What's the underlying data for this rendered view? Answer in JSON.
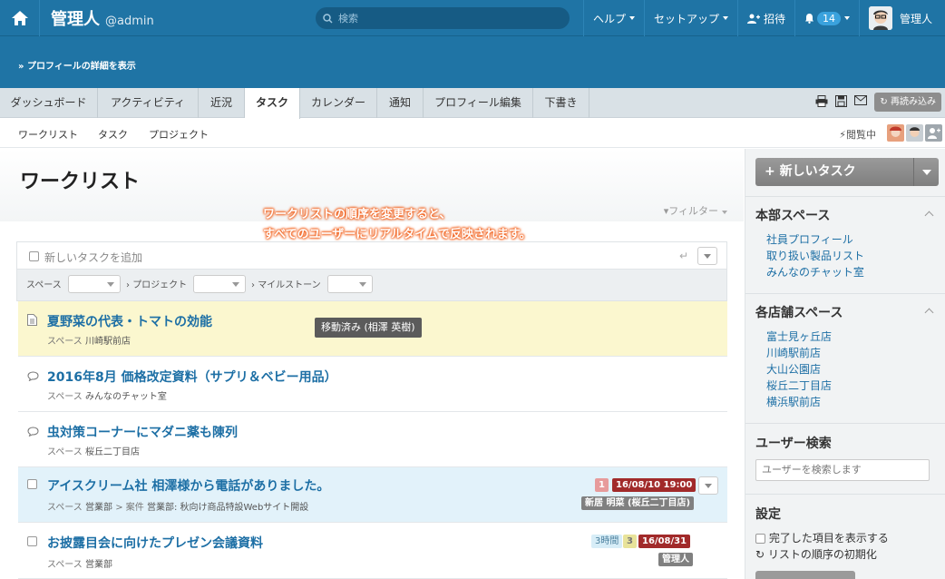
{
  "header": {
    "brand": "管理人",
    "handle": "@admin",
    "search_placeholder": "検索",
    "help": "ヘルプ",
    "setup": "セットアップ",
    "invite": "招待",
    "notif_count": "14",
    "user_name": "管理人"
  },
  "profile": {
    "details_link": "» プロフィールの詳細を表示"
  },
  "tabs": [
    "ダッシュボード",
    "アクティビティ",
    "近況",
    "タスク",
    "カレンダー",
    "通知",
    "プロフィール編集",
    "下書き"
  ],
  "active_tab": "タスク",
  "reload": "再読み込み",
  "subtabs": [
    "ワークリスト",
    "タスク",
    "プロジェクト"
  ],
  "viewing": "閲覧中",
  "page": {
    "title": "ワークリスト",
    "filter": "フィルター",
    "callout_line1": "ワークリストの順序を変更すると、",
    "callout_line2": "すべてのユーザーにリアルタイムで反映されます。"
  },
  "form": {
    "add_placeholder": "新しいタスクを追加",
    "space_label": "スペース",
    "project_label": "プロジェクト",
    "milestone_label": "マイルストーン"
  },
  "tooltip": "移動済み (相澤 英樹)",
  "tasks": [
    {
      "title": "夏野菜の代表・トマトの効能",
      "meta_label": "スペース",
      "meta_value": "川崎駅前店",
      "icon": "document-icon",
      "bg": "#fbf7cf"
    },
    {
      "title": "2016年8月 価格改定資料（サプリ＆ベビー用品）",
      "meta_label": "スペース",
      "meta_value": "みんなのチャット室",
      "icon": "comment-icon",
      "bg": "#ffffff"
    },
    {
      "title": "虫対策コーナーにマダニ薬も陳列",
      "meta_label": "スペース",
      "meta_value": "桜丘二丁目店",
      "icon": "comment-icon",
      "bg": "#ffffff"
    },
    {
      "title": "アイスクリーム社 相澤様から電話がありました。",
      "meta_label": "スペース",
      "meta_value": "営業部",
      "meta_extra_label": "案件",
      "meta_extra_value": "営業部: 秋向け商品特設Webサイト開設",
      "icon": "checkbox-icon",
      "bg": "#e2f2fa",
      "badge_num": "1",
      "due": "16/08/10 19:00",
      "assignee": "新居 明菜 (桜丘二丁目店)"
    },
    {
      "title": "お披露目会に向けたプレゼン会議資料",
      "meta_label": "スペース",
      "meta_value": "営業部",
      "icon": "checkbox-icon",
      "bg": "#ffffff",
      "estimate": "3時間",
      "badge_num": "3",
      "due": "16/08/31",
      "assignee": "管理人"
    }
  ],
  "sidebar": {
    "new_task": "新しいタスク",
    "hq_heading": "本部スペース",
    "hq_links": [
      "社員プロフィール",
      "取り扱い製品リスト",
      "みんなのチャット室"
    ],
    "store_heading": "各店舗スペース",
    "store_links": [
      "富士見ヶ丘店",
      "川崎駅前店",
      "大山公園店",
      "桜丘二丁目店",
      "横浜駅前店"
    ],
    "user_search_heading": "ユーザー検索",
    "user_search_placeholder": "ユーザーを検索します",
    "settings_heading": "設定",
    "show_completed": "完了した項目を表示する",
    "reset_order": "リストの順序の初期化"
  },
  "colors": {
    "brand": "#1f74a5",
    "link": "#1d6fa5",
    "due_red": "#a12a2a",
    "highlight": "#fbf7cf"
  }
}
